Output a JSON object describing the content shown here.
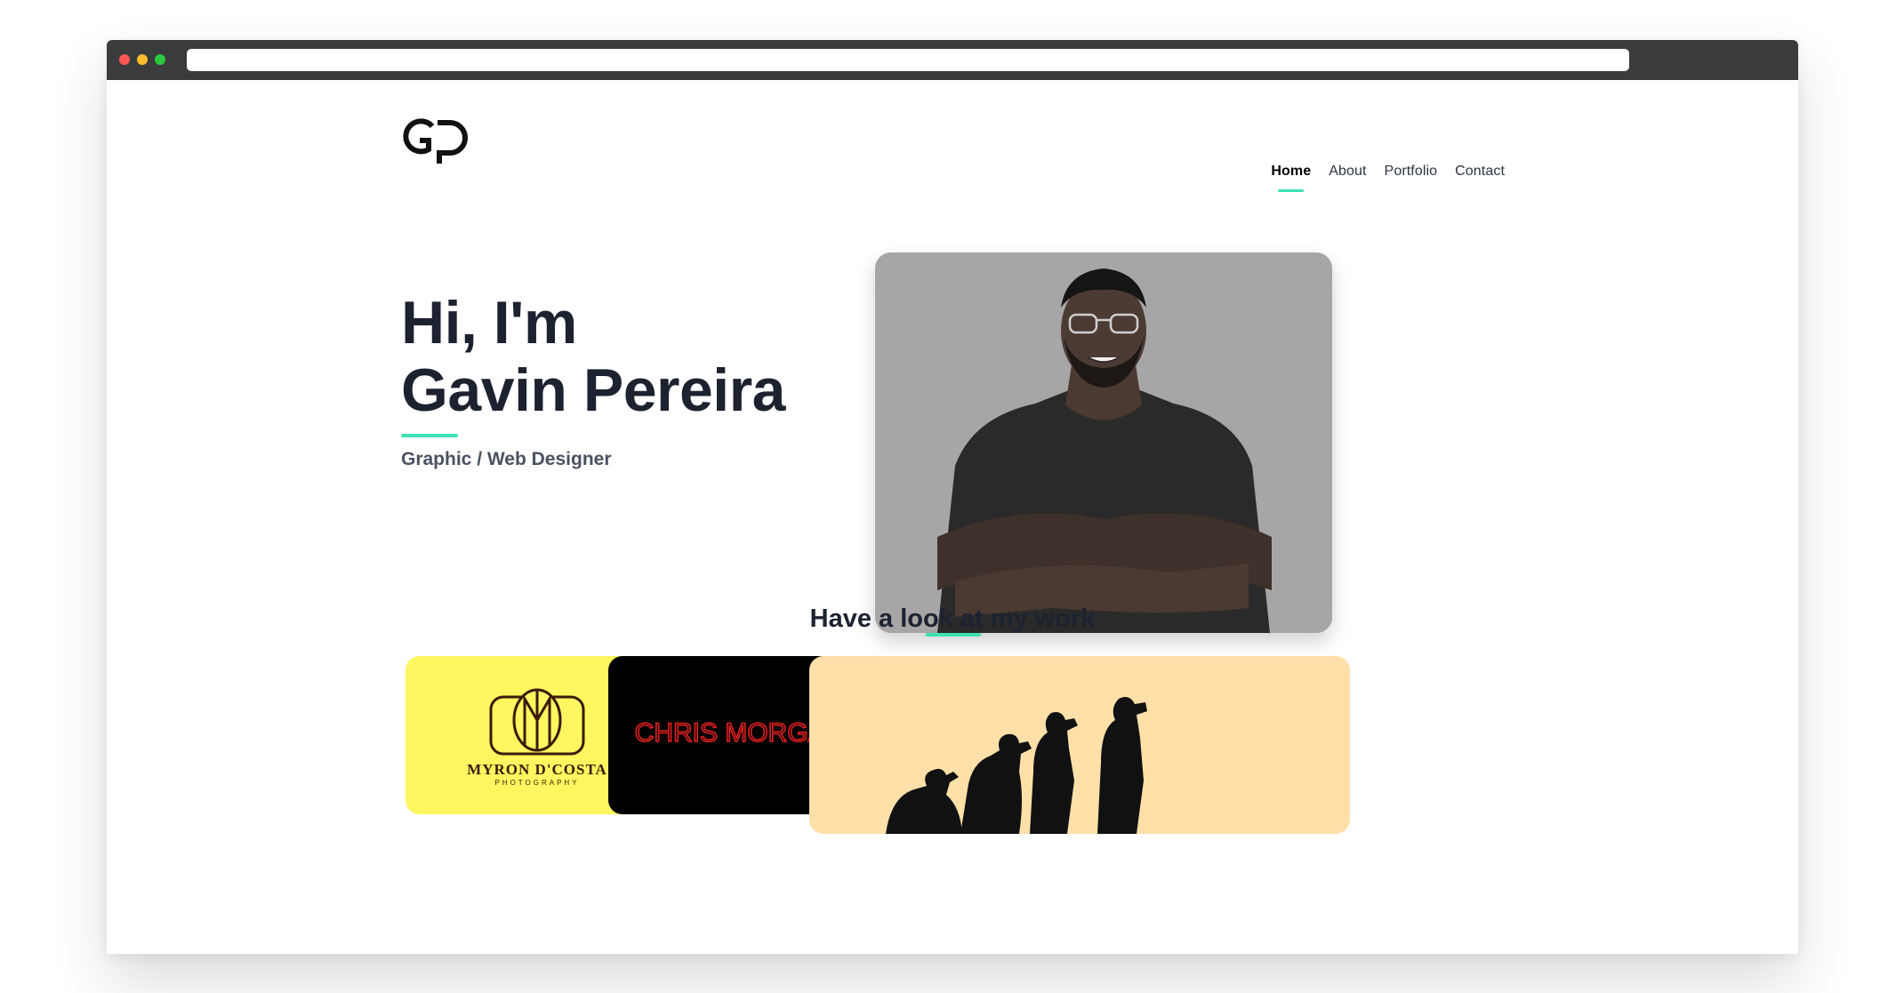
{
  "browser": {
    "url": ""
  },
  "header": {
    "logo_alt": "GP",
    "nav": [
      {
        "label": "Home",
        "active": true
      },
      {
        "label": "About",
        "active": false
      },
      {
        "label": "Portfolio",
        "active": false
      },
      {
        "label": "Contact",
        "active": false
      }
    ]
  },
  "hero": {
    "greeting": "Hi, I'm",
    "name": "Gavin Pereira",
    "role": "Graphic / Web Designer"
  },
  "work": {
    "heading": "Have a look at my work",
    "cards": [
      {
        "brand": "MYRON D'COSTA",
        "tagline": "PHOTOGRAPHY"
      },
      {
        "brand": "CHRIS MORGAN"
      }
    ]
  },
  "colors": {
    "accent": "#3de1b3",
    "text_dark": "#1c2230",
    "card_yellow": "#fff760",
    "card_black": "#000000",
    "card_peach": "#ffe0a9"
  },
  "icons": [
    "gp-logo-icon"
  ]
}
